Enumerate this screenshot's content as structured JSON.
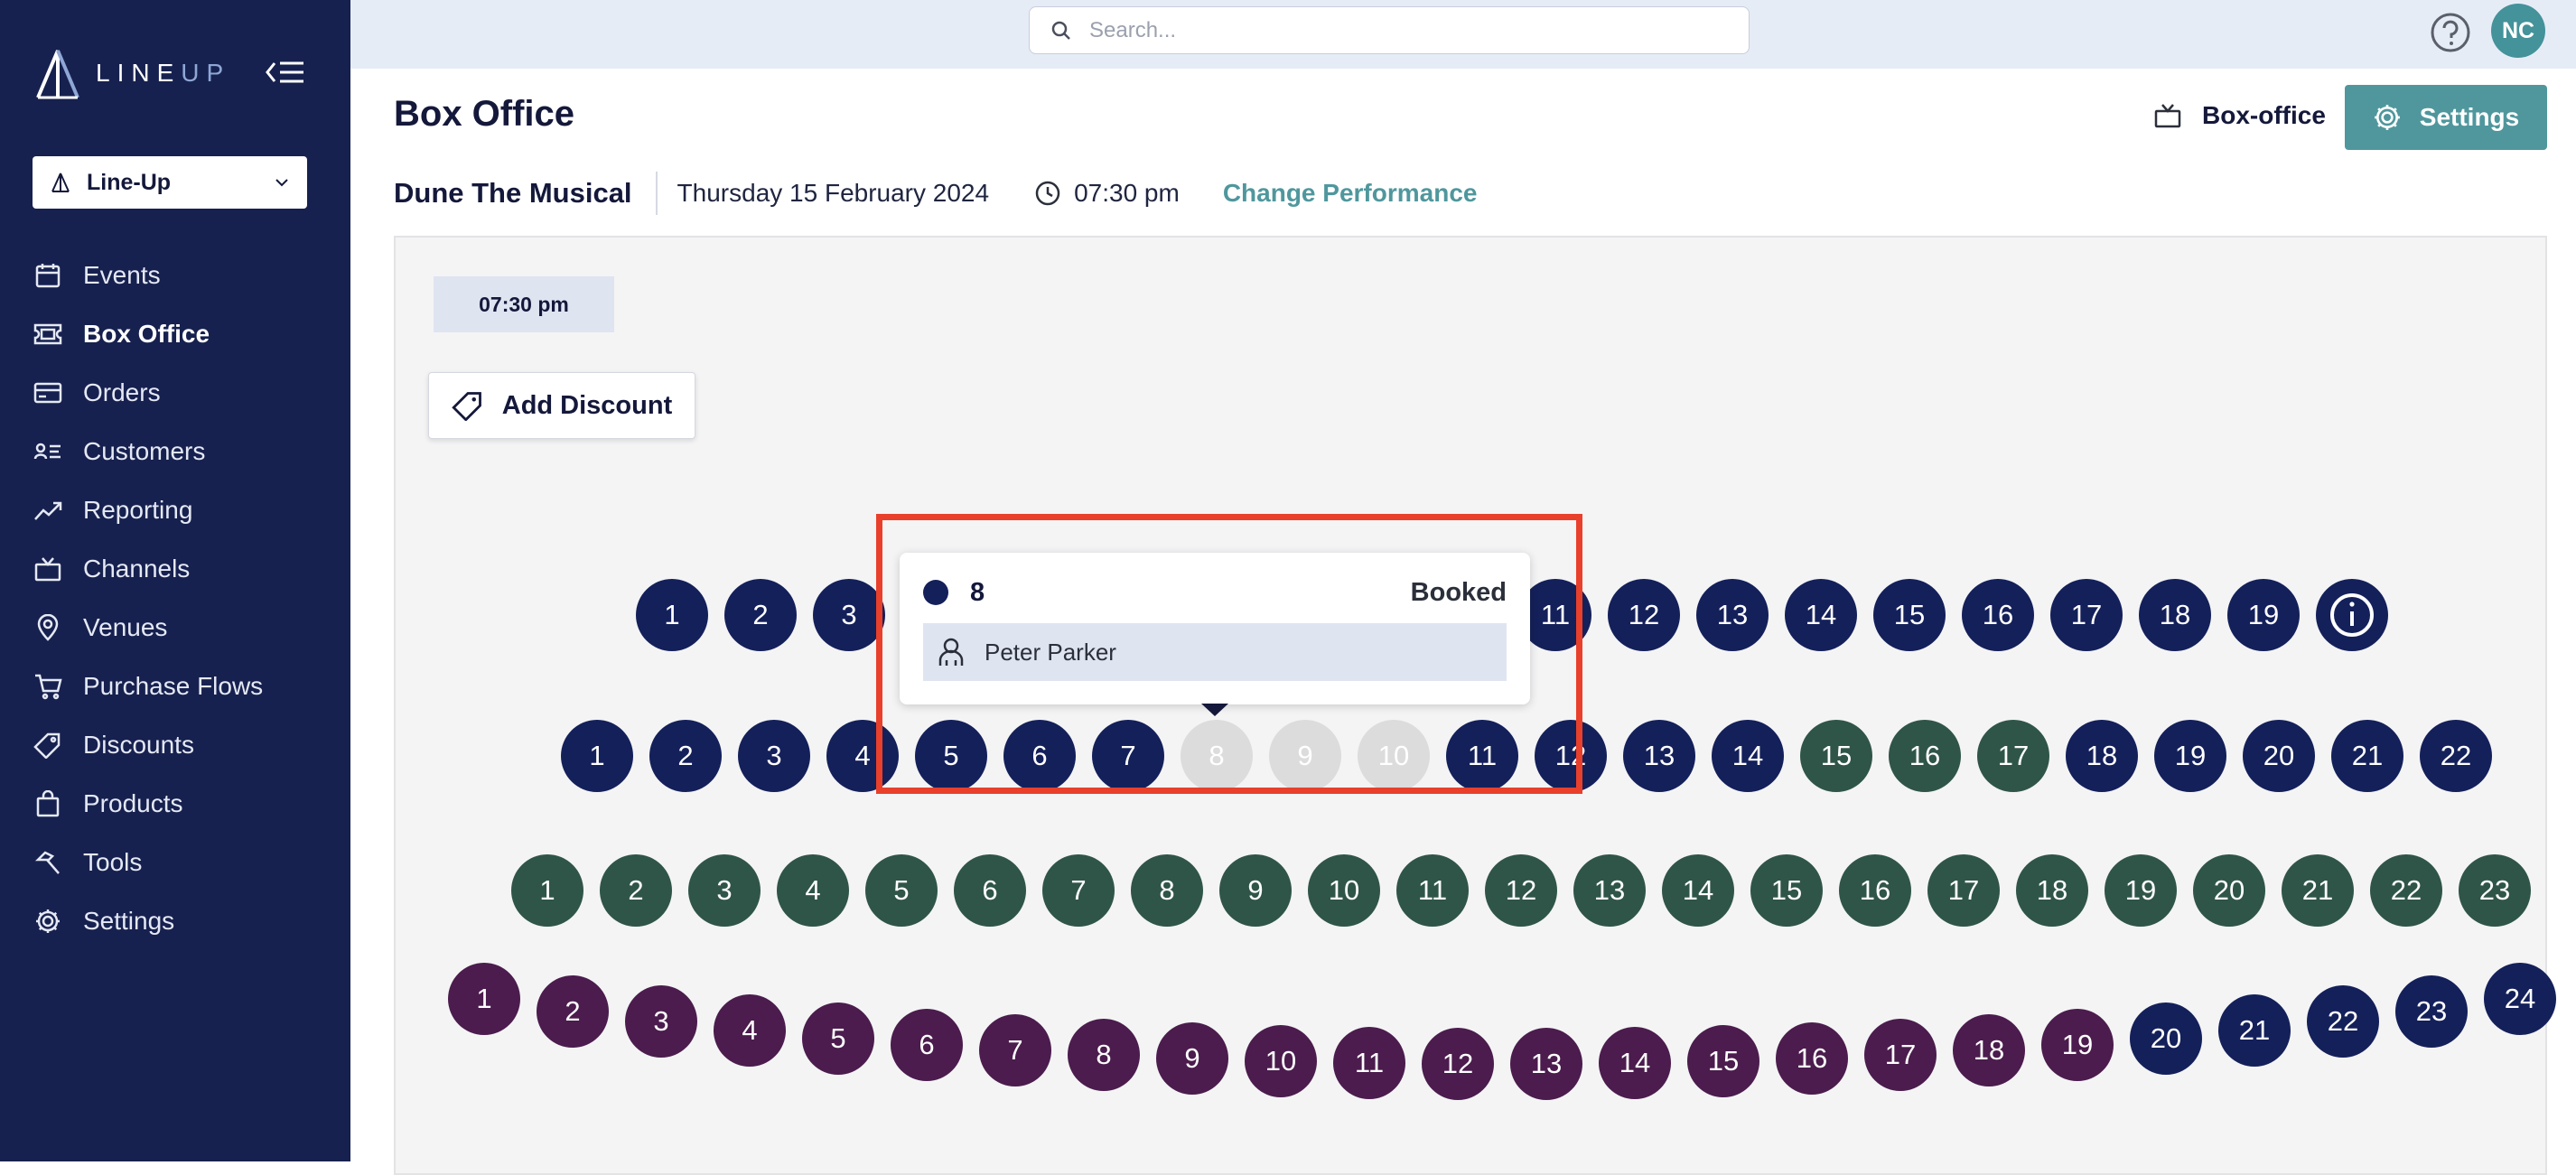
{
  "brand": {
    "logo_text_main": "LINE",
    "logo_text_accent": "UP"
  },
  "sidebar": {
    "org_select": {
      "value": "Line-Up"
    },
    "items": [
      {
        "label": "Events",
        "icon": "calendar-icon",
        "active": false
      },
      {
        "label": "Box Office",
        "icon": "ticket-icon",
        "active": true
      },
      {
        "label": "Orders",
        "icon": "credit-card-icon",
        "active": false
      },
      {
        "label": "Customers",
        "icon": "customer-list-icon",
        "active": false
      },
      {
        "label": "Reporting",
        "icon": "trend-chart-icon",
        "active": false
      },
      {
        "label": "Channels",
        "icon": "tv-icon",
        "active": false
      },
      {
        "label": "Venues",
        "icon": "map-pin-icon",
        "active": false
      },
      {
        "label": "Purchase Flows",
        "icon": "cart-icon",
        "active": false
      },
      {
        "label": "Discounts",
        "icon": "tag-icon",
        "active": false
      },
      {
        "label": "Products",
        "icon": "shopping-bag-icon",
        "active": false
      },
      {
        "label": "Tools",
        "icon": "hammer-icon",
        "active": false
      },
      {
        "label": "Settings",
        "icon": "gear-icon",
        "active": false
      }
    ]
  },
  "topbar": {
    "search_placeholder": "Search...",
    "avatar_initials": "NC"
  },
  "header": {
    "title": "Box Office",
    "boxoffice_label": "Box-office",
    "settings_label": "Settings"
  },
  "performance": {
    "event_name": "Dune The Musical",
    "date": "Thursday 15 February 2024",
    "time": "07:30 pm",
    "change_label": "Change Performance"
  },
  "panel": {
    "time_chip": "07:30 pm",
    "add_discount_label": "Add Discount"
  },
  "seating": {
    "rows": [
      {
        "numbers": [
          1,
          2,
          3,
          11,
          12,
          13,
          14,
          15,
          16,
          17,
          18,
          19
        ],
        "colors": "navy"
      },
      {
        "numbers": [
          1,
          2,
          3,
          4,
          5,
          6,
          7,
          8,
          9,
          10,
          11,
          12,
          13,
          14,
          15,
          16,
          17,
          18,
          19,
          20,
          21,
          22
        ],
        "booked": [
          8,
          9,
          10
        ],
        "green": [
          15,
          16,
          17
        ]
      },
      {
        "numbers": [
          1,
          2,
          3,
          4,
          5,
          6,
          7,
          8,
          9,
          10,
          11,
          12,
          13,
          14,
          15,
          16,
          17,
          18,
          19,
          20,
          21,
          22,
          23
        ],
        "colors": "green"
      },
      {
        "numbers": [
          1,
          2,
          3,
          4,
          5,
          6,
          7,
          8,
          9,
          10,
          11,
          12,
          13,
          14,
          15,
          16,
          17,
          18,
          19,
          20,
          21,
          22,
          23,
          24
        ],
        "navy": [
          20,
          21,
          22,
          23,
          24
        ]
      }
    ]
  },
  "tooltip": {
    "seat": "8",
    "status": "Booked",
    "customer": "Peter Parker"
  },
  "colors": {
    "sidebar_bg": "#17214f",
    "accent": "#4f979d",
    "seat_navy": "#14205a",
    "seat_green": "#2f5548",
    "seat_purple": "#4b1c4d",
    "seat_booked": "#dcdcdc",
    "highlight": "#e8402b"
  }
}
